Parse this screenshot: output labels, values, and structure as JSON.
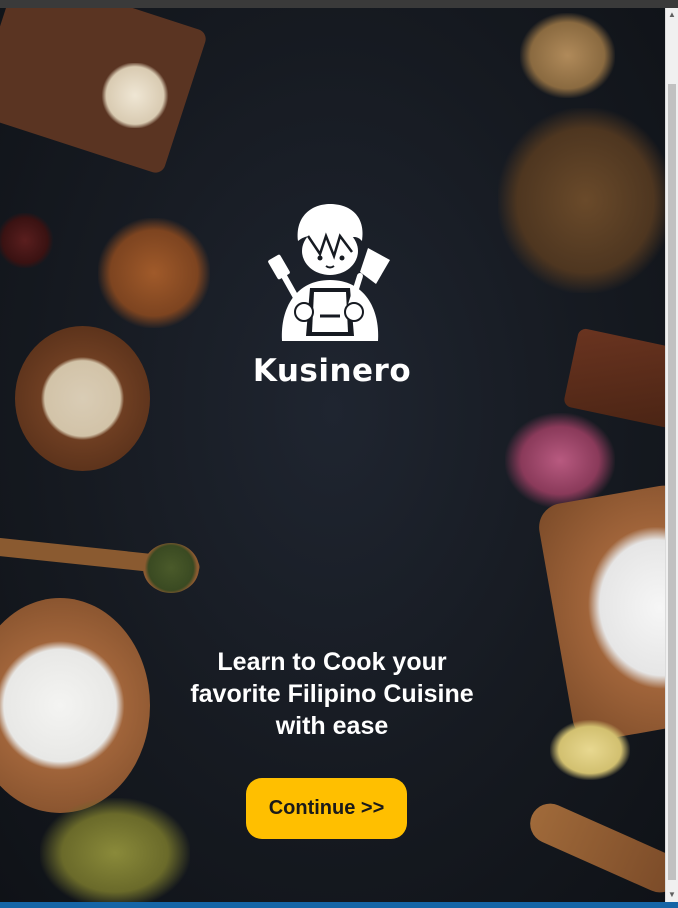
{
  "app": {
    "brand_name": "Kusinero",
    "tagline_line1": "Learn to Cook your",
    "tagline_line2": "favorite Filipino Cuisine",
    "tagline_line3": "with ease",
    "continue_label": "Continue >>"
  },
  "icons": {
    "logo": "chef-with-spatula-and-cleaver-icon"
  },
  "colors": {
    "background": "#161a21",
    "button": "#ffbf00",
    "button_text": "#1a1a1a",
    "text": "#ffffff",
    "taskbar": "#1565a6"
  }
}
